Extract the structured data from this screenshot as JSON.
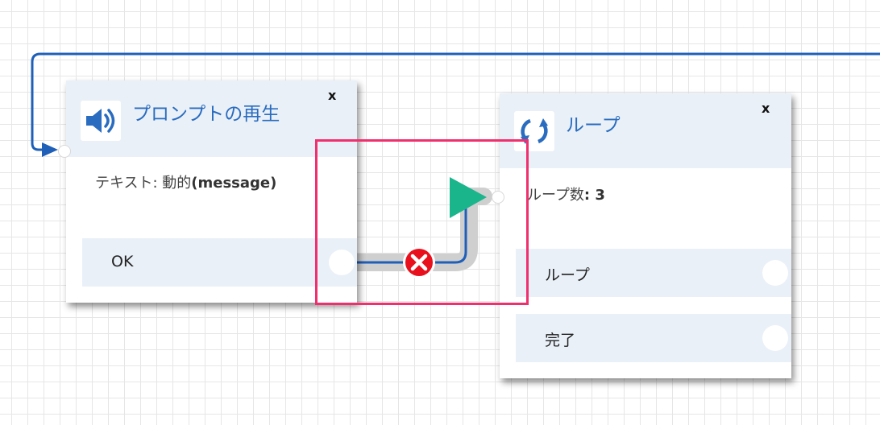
{
  "blocks": {
    "play_prompt": {
      "title": "プロンプトの再生",
      "close_label": "x",
      "icon": "speaker-icon",
      "info_prefix": "テキスト: ",
      "info_value_plain": "動的",
      "info_value_bold": "(message)",
      "branches": [
        {
          "label": "OK"
        }
      ]
    },
    "loop": {
      "title": "ループ",
      "close_label": "x",
      "icon": "loop-icon",
      "info_prefix": "ループ数",
      "info_value_bold": ": 3",
      "branches": [
        {
          "label": "ループ"
        },
        {
          "label": "完了"
        }
      ]
    }
  },
  "connection": {
    "from": "OK",
    "to": "ループ",
    "delete_icon": "delete-connection-icon",
    "arrow_icon": "connector-arrow-icon"
  },
  "colors": {
    "accent": "#2a6cbf",
    "header_bg": "#e9f0f8",
    "wire": "#1f5fb8",
    "arrow": "#1bb58c",
    "delete": "#e8101c",
    "highlight": "#f0306e"
  }
}
